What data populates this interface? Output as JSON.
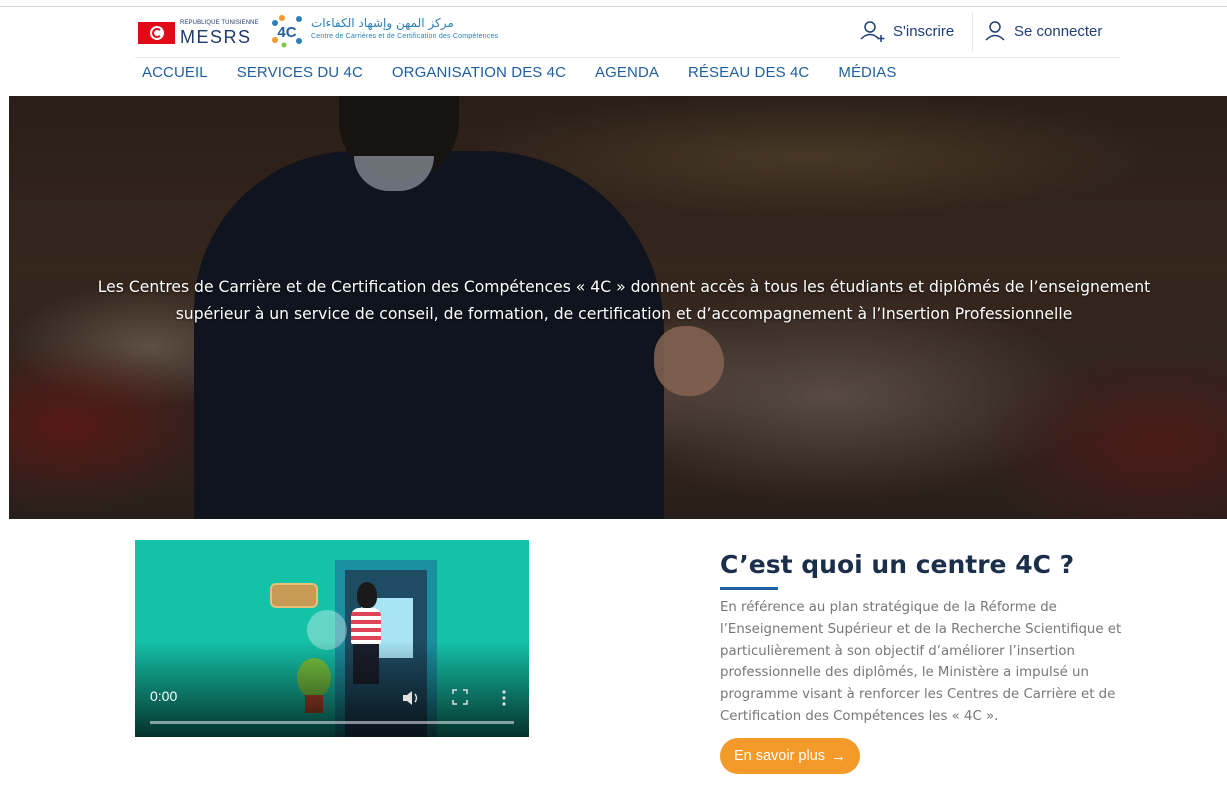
{
  "header": {
    "republic_label": "REPUBLIQUE TUNISIENNE",
    "ministry_label": "MESRS",
    "logo_text": "4C",
    "arabic_title": "مركز المهن وإشهاد الكفاءات",
    "centre_subtitle": "Centre de Carrières et de Certification des Compétences",
    "register_label": "S'inscrire",
    "login_label": "Se connecter"
  },
  "nav": {
    "items": [
      {
        "label": "ACCUEIL"
      },
      {
        "label": "SERVICES DU 4C"
      },
      {
        "label": "ORGANISATION DES 4C"
      },
      {
        "label": "AGENDA"
      },
      {
        "label": "RÉSEAU DES 4C"
      },
      {
        "label": "MÉDIAS"
      }
    ]
  },
  "hero": {
    "text": "Les Centres de Carrière et de Certification des Compétences « 4C » donnent accès à tous les étudiants et diplômés de l’enseignement supérieur à un service de conseil, de formation, de certification et d’accompagnement à l’Insertion Professionnelle"
  },
  "video": {
    "time": "0:00"
  },
  "about": {
    "title": "C’est quoi un centre 4C ?",
    "body": "En référence au plan stratégique de la Réforme de l’Enseignement Supérieur et de la Recherche Scientifique et particulièrement à son objectif d’améliorer l’insertion professionnelle des diplômés, le Ministère a impulsé un programme visant à renforcer les Centres de Carrière et de Certification des Compétences les « 4C ».",
    "button_label": "En savoir plus",
    "button_color": "#f39a2b"
  },
  "colors": {
    "nav": "#1f5fa0",
    "brand_dark": "#1f3f77"
  }
}
